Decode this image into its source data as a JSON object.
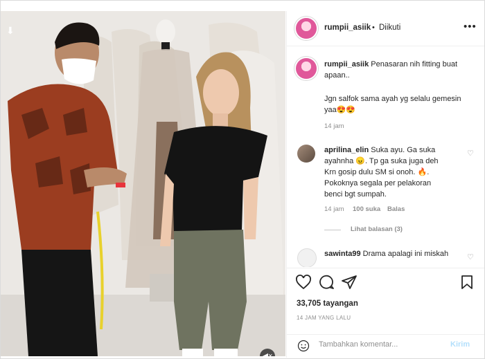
{
  "post": {
    "username": "rumpii_asiik",
    "separator": "•",
    "follow_status": "Diikuti",
    "more_icon": "more-horizontal-icon"
  },
  "caption": {
    "username": "rumpii_asiik",
    "text_line1": "Penasaran nih fitting buat",
    "text_line2": "apaan..",
    "text_line3": "Jgn salfok sama ayah yg selalu gemesin",
    "text_line4": "yaa😍😍",
    "time": "14 jam"
  },
  "comments": [
    {
      "username": "aprilina_elin",
      "lines": [
        "Suka ayu. Ga suka",
        "ayahnha 😠. Tp ga suka juga deh",
        "Krn gosip dulu SM si onoh. 🔥.",
        "Pokoknya segala per pelakoran",
        "benci bgt sumpah."
      ],
      "time": "14 jam",
      "likes": "100 suka",
      "reply": "Balas",
      "view_replies": "Lihat balasan (3)"
    },
    {
      "username": "sawinta99",
      "text": "Drama apalagi ini miskah"
    }
  ],
  "views": "33,705 tayangan",
  "posted_ago": "14 JAM YANG LALU",
  "add_comment": {
    "placeholder": "Tambahkan komentar...",
    "post_label": "Kirim"
  }
}
